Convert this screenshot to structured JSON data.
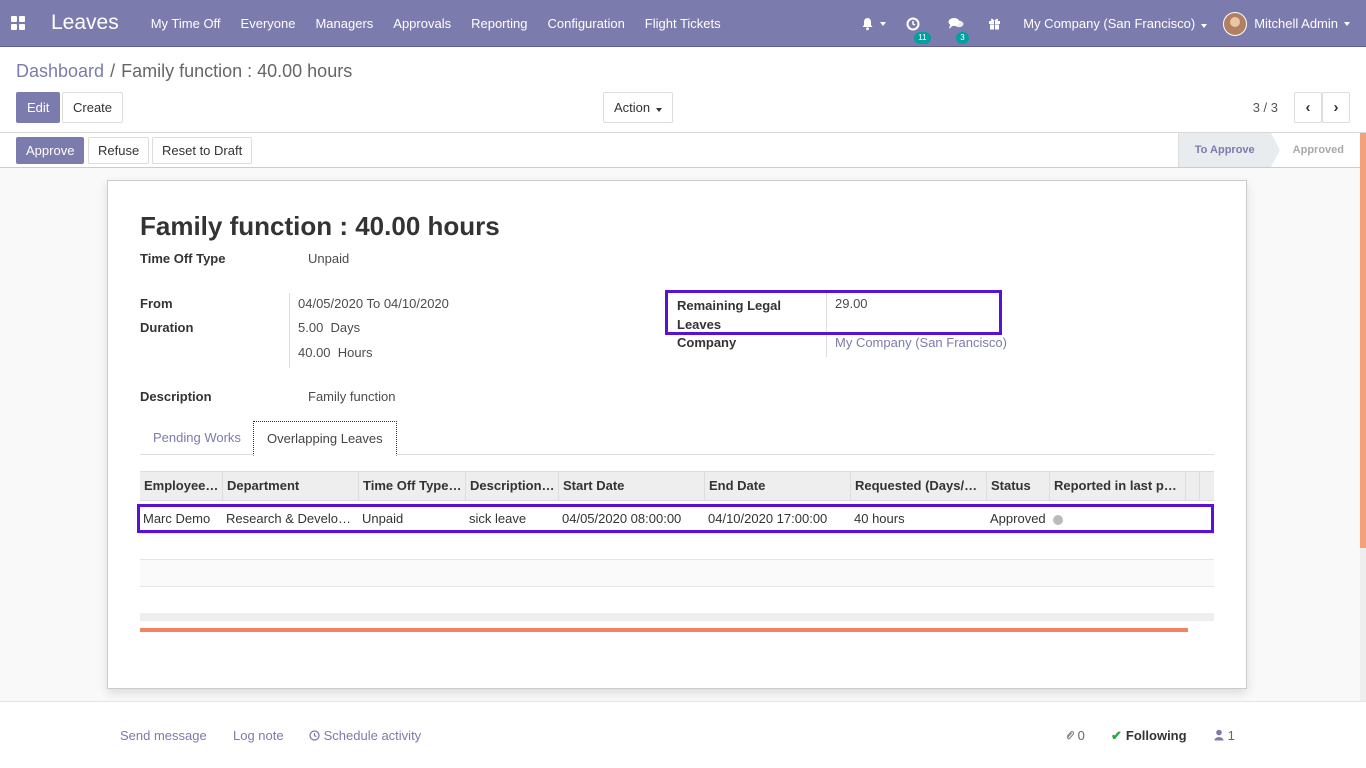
{
  "navbar": {
    "app_title": "Leaves",
    "menu": [
      "My Time Off",
      "Everyone",
      "Managers",
      "Approvals",
      "Reporting",
      "Configuration",
      "Flight Tickets"
    ],
    "activity_count": "11",
    "messages_count": "3",
    "company": "My Company (San Francisco)",
    "user": "Mitchell Admin"
  },
  "control_panel": {
    "breadcrumb_parent": "Dashboard",
    "breadcrumb_separator": "/",
    "breadcrumb_current": "Family function : 40.00 hours",
    "edit_label": "Edit",
    "create_label": "Create",
    "action_label": "Action",
    "pager": "3 / 3",
    "prev_symbol": "‹",
    "next_symbol": "›"
  },
  "statusbar": {
    "approve_label": "Approve",
    "refuse_label": "Refuse",
    "reset_label": "Reset to Draft",
    "stages": [
      "To Approve",
      "Approved"
    ],
    "active_stage": "To Approve"
  },
  "form": {
    "title": "Family function : 40.00 hours",
    "time_off_type_label": "Time Off Type",
    "time_off_type": "Unpaid",
    "from_label": "From",
    "from_date": "04/05/2020",
    "to_word": "To",
    "to_date": "04/10/2020",
    "duration_label": "Duration",
    "days_value": "5.00",
    "days_unit": "Days",
    "hours_value": "40.00",
    "hours_unit": "Hours",
    "remaining_label_1": "Remaining Legal",
    "remaining_label_2": "Leaves",
    "remaining_value": "29.00",
    "company_label": "Company",
    "company_value": "My Company (San Francisco)",
    "description_label": "Description",
    "description_value": "Family function"
  },
  "tabs": [
    {
      "label": "Pending Works",
      "active": false
    },
    {
      "label": "Overlapping Leaves",
      "active": true
    }
  ],
  "table": {
    "columns": [
      "Employee…",
      "Department",
      "Time Off Type…",
      "Description…",
      "Start Date",
      "End Date",
      "Requested (Days/…",
      "Status",
      "Reported in last p…"
    ],
    "rows": [
      {
        "employee": "Marc Demo",
        "department": "Research & Develo…",
        "type": "Unpaid",
        "description": "sick leave",
        "start": "04/05/2020 08:00:00",
        "end": "04/10/2020 17:00:00",
        "requested": "40 hours",
        "status": "Approved"
      }
    ]
  },
  "chatter": {
    "send_message": "Send message",
    "log_note": "Log note",
    "schedule_activity": "Schedule activity",
    "attachments": "0",
    "following": "Following",
    "followers": "1"
  },
  "colors": {
    "brand": "#7c7bad",
    "highlight": "#5a11d6",
    "accent_bar": "#f4845f"
  }
}
